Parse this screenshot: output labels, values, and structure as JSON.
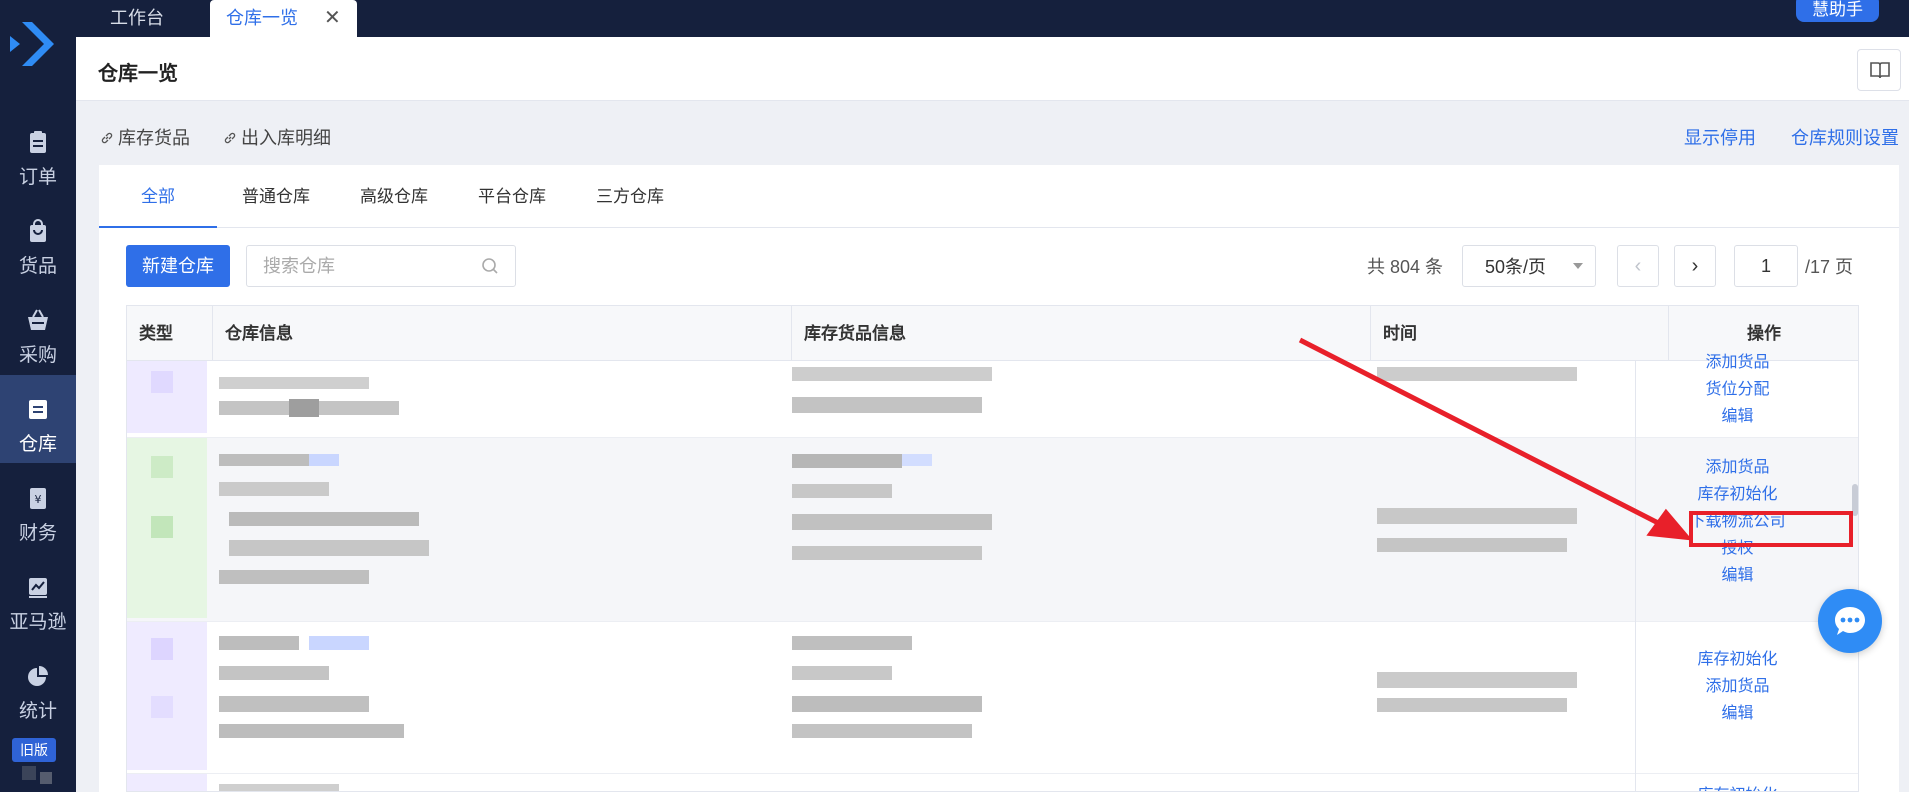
{
  "sidebar": {
    "items": [
      {
        "label": "订单",
        "icon": "clipboard-icon"
      },
      {
        "label": "货品",
        "icon": "bag-icon"
      },
      {
        "label": "采购",
        "icon": "basket-icon"
      },
      {
        "label": "仓库",
        "icon": "warehouse-icon",
        "active": true
      },
      {
        "label": "财务",
        "icon": "finance-icon"
      },
      {
        "label": "亚马逊",
        "icon": "chart-line-icon"
      },
      {
        "label": "统计",
        "icon": "pie-chart-icon"
      }
    ],
    "old_version": "旧版"
  },
  "topbar": {
    "tabs": [
      {
        "label": "工作台"
      },
      {
        "label": "仓库一览",
        "active": true
      }
    ],
    "helper": "慧助手"
  },
  "page": {
    "title": "仓库一览"
  },
  "links": {
    "inventory_goods": "库存货品",
    "inout_detail": "出入库明细",
    "show_disabled": "显示停用",
    "warehouse_rules": "仓库规则设置"
  },
  "tabs": [
    "全部",
    "普通仓库",
    "高级仓库",
    "平台仓库",
    "三方仓库"
  ],
  "toolbar": {
    "new_button": "新建仓库",
    "search_placeholder": "搜索仓库",
    "total": "共 804 条",
    "page_size": "50条/页",
    "current_page": "1",
    "total_pages": "/17 页"
  },
  "table": {
    "columns": [
      "类型",
      "仓库信息",
      "库存货品信息",
      "时间",
      "操作"
    ],
    "rows": [
      {
        "ops": [
          "添加货品",
          "货位分配",
          "编辑"
        ]
      },
      {
        "ops": [
          "添加货品",
          "库存初始化",
          "下载物流公司",
          "授权",
          "编辑"
        ]
      },
      {
        "ops": [
          "库存初始化",
          "添加货品",
          "编辑"
        ]
      },
      {
        "ops": [
          "库存初始化"
        ]
      }
    ]
  },
  "colors": {
    "accent": "#2f6fe8",
    "sidebar_bg": "#15203d",
    "annotation_red": "#e8202a"
  }
}
